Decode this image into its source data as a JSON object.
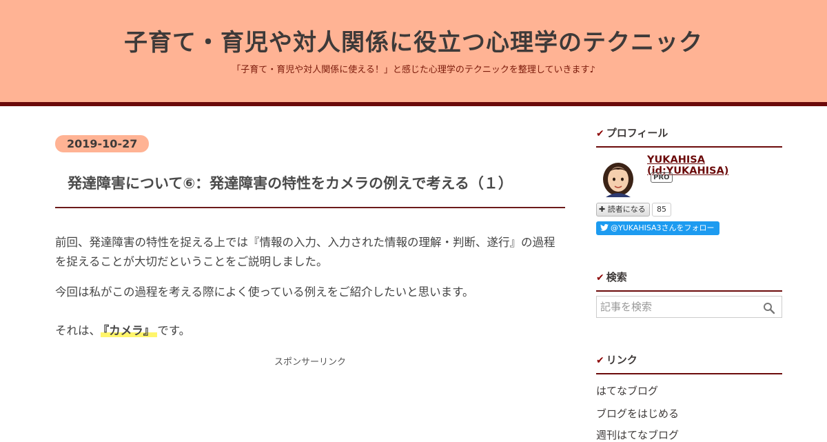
{
  "header": {
    "title": "子育て・育児や対人関係に役立つ心理学のテクニック",
    "description": "「子育て・育児や対人関係に使える！」と感じた心理学のテクニックを整理していきます♪"
  },
  "entry": {
    "date": "2019-10-27",
    "title": "発達障害について⑥：発達障害の特性をカメラの例えで考える（１）",
    "paragraph1": "前回、発達障害の特性を捉える上では『情報の入力、入力された情報の理解・判断、遂行』の過程を捉えることが大切だということをご説明しました。",
    "paragraph2": "今回は私がこの過程を考える際によく使っている例えをご紹介したいと思います。",
    "paragraph3_before": "それは、",
    "paragraph3_highlight": "『カメラ』",
    "paragraph3_after": "です。",
    "sponsor_label": "スポンサーリンク"
  },
  "sidebar": {
    "profile": {
      "heading": "プロフィール",
      "name": "YUKAHISA (id:YUKAHISA)",
      "badge": "PRO",
      "reader_button": "読者になる",
      "reader_count": "85",
      "twitter_follow": "@YUKAHISA3さんをフォロー"
    },
    "search": {
      "heading": "検索",
      "placeholder": "記事を検索"
    },
    "links": {
      "heading": "リンク",
      "items": [
        "はてなブログ",
        "ブログをはじめる",
        "週刊はてなブログ"
      ]
    }
  },
  "colors": {
    "header_bg": "#ffb394",
    "accent_dark_red": "#6b0a0a",
    "twitter_blue": "#1d9bf0",
    "highlight_yellow": "#fff56b"
  },
  "icons": [
    "check-icon",
    "avatar",
    "plus-icon",
    "twitter-bird-icon",
    "search-icon"
  ]
}
